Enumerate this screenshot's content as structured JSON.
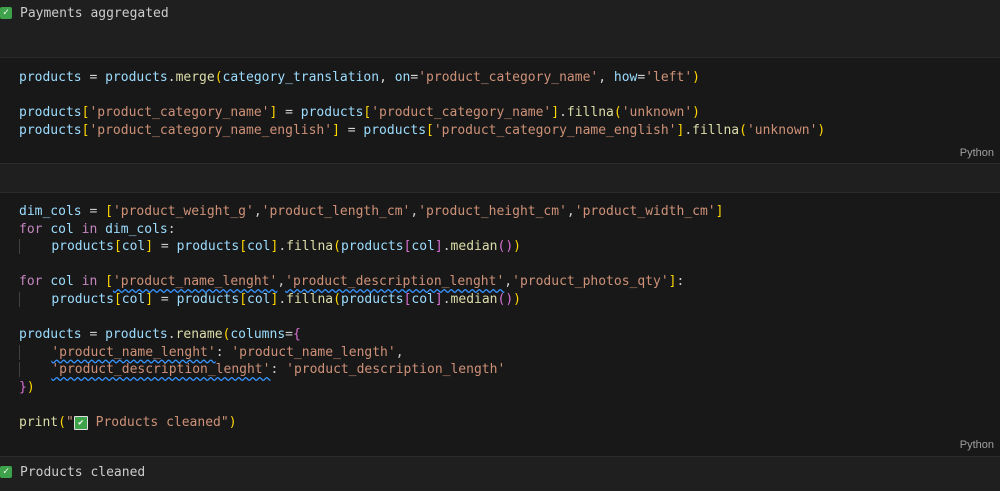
{
  "outputs": {
    "first": "Payments aggregated",
    "last": "Products cleaned"
  },
  "cell1": {
    "language": "Python",
    "line1": {
      "lhs": "products",
      "eq": " = ",
      "obj": "products",
      "dot": ".",
      "fn": "merge",
      "open": "(",
      "arg1": "category_translation",
      "comma1": ", ",
      "kw1": "on",
      "eq1": "=",
      "val1": "'product_category_name'",
      "comma2": ", ",
      "kw2": "how",
      "eq2": "=",
      "val2": "'left'",
      "close": ")"
    },
    "line2": {
      "lhs": "products",
      "key": "'product_category_name'",
      "eq": " = ",
      "obj": "products",
      "key2": "'product_category_name'",
      "fn": "fillna",
      "val": "'unknown'"
    },
    "line3": {
      "lhs": "products",
      "key": "'product_category_name_english'",
      "eq": " = ",
      "obj": "products",
      "key2": "'product_category_name_english'",
      "fn": "fillna",
      "val": "'unknown'"
    }
  },
  "cell2": {
    "language": "Python",
    "dim_var": "dim_cols",
    "dim_items": [
      "'product_weight_g'",
      "'product_length_cm'",
      "'product_height_cm'",
      "'product_width_cm'"
    ],
    "for_kw": "for",
    "in_kw": "in",
    "col_var": "col",
    "products": "products",
    "fillna": "fillna",
    "median": "median",
    "list2": [
      "'product_name_lenght'",
      "'product_description_lenght'",
      "'product_photos_qty'"
    ],
    "rename": "rename",
    "columns_kw": "columns",
    "map": [
      {
        "k": "'product_name_lenght'",
        "v": "'product_name_length'"
      },
      {
        "k": "'product_description_lenght'",
        "v": "'product_description_length'"
      }
    ],
    "print_fn": "print",
    "print_q1": "\"",
    "print_emoji": "✔",
    "print_text": " Products cleaned\""
  },
  "colors": {
    "background": "#1f1f1f",
    "cell_background": "#181818",
    "check_green": "#3ea24a",
    "string": "#ce9178",
    "function": "#dcdcaa",
    "variable": "#9cdcfe",
    "keyword": "#c586c0"
  }
}
